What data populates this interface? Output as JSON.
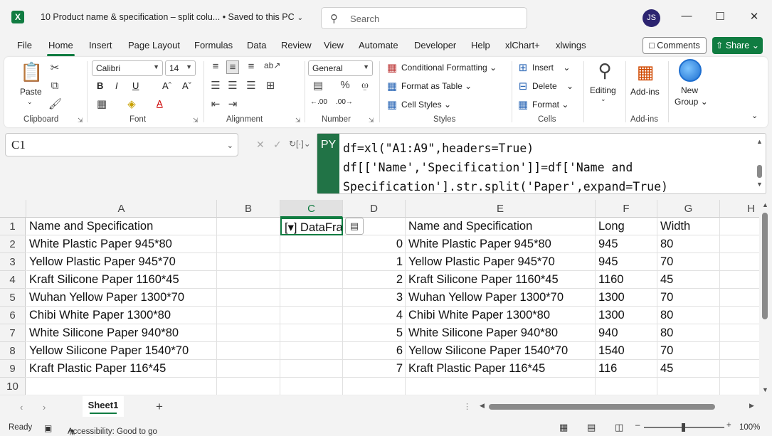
{
  "titlebar": {
    "logo": "X",
    "doc_title": "10 Product name & specification – split colu... • Saved to this PC",
    "search_placeholder": "Search",
    "avatar_initials": "JS"
  },
  "menu": {
    "tabs": [
      "File",
      "Home",
      "Insert",
      "Page Layout",
      "Formulas",
      "Data",
      "Review",
      "View",
      "Automate",
      "Developer",
      "Help",
      "xlChart+",
      "xlwings"
    ],
    "active": "Home",
    "comments_label": "Comments",
    "share_label": "Share"
  },
  "ribbon": {
    "clipboard": {
      "paste": "Paste",
      "label": "Clipboard"
    },
    "font": {
      "name": "Calibri",
      "size": "14",
      "label": "Font"
    },
    "alignment": {
      "label": "Alignment"
    },
    "number": {
      "format": "General",
      "label": "Number"
    },
    "styles": {
      "conditional": "Conditional Formatting",
      "format_table": "Format as Table",
      "cell_styles": "Cell Styles",
      "label": "Styles"
    },
    "cells": {
      "insert": "Insert",
      "delete": "Delete",
      "format": "Format",
      "label": "Cells"
    },
    "editing": {
      "label": "Editing"
    },
    "addins": {
      "button": "Add-ins",
      "label": "Add-ins"
    },
    "newgroup": {
      "line1": "New",
      "line2": "Group"
    }
  },
  "formula": {
    "name_box": "C1",
    "py_badge": "PY",
    "lines": [
      "df=xl(\"A1:A9\",headers=True)",
      "df[['Name','Specification']]=df['Name and",
      "Specification'].str.split('Paper',expand=True)"
    ]
  },
  "grid": {
    "columns": [
      "A",
      "B",
      "C",
      "D",
      "E",
      "F",
      "G",
      "H"
    ],
    "selected_column": "C",
    "rows": [
      "1",
      "2",
      "3",
      "4",
      "5",
      "6",
      "7",
      "8",
      "9",
      "10"
    ],
    "col_a": [
      "Name and Specification",
      "White Plastic Paper 945*80",
      "Yellow Plastic Paper 945*70",
      "Kraft Silicone Paper 1160*45",
      "Wuhan Yellow Paper 1300*70",
      "Chibi White Paper 1300*80",
      "White Silicone Paper 940*80",
      "Yellow Silicone Paper 1540*70",
      "Kraft Plastic Paper 116*45"
    ],
    "c1_value": "[▾] DataFra",
    "col_d": [
      "",
      "0",
      "1",
      "2",
      "3",
      "4",
      "5",
      "6",
      "7"
    ],
    "col_e": [
      "Name and Specification",
      "White Plastic Paper 945*80",
      "Yellow Plastic Paper 945*70",
      "Kraft Silicone Paper 1160*45",
      "Wuhan Yellow Paper 1300*70",
      "Chibi White Paper 1300*80",
      "White Silicone Paper 940*80",
      "Yellow Silicone Paper 1540*70",
      "Kraft Plastic Paper 116*45"
    ],
    "col_f": [
      "Long",
      "945",
      "945",
      "1160",
      "1300",
      "1300",
      "940",
      "1540",
      "116"
    ],
    "col_g": [
      "Width",
      "80",
      "70",
      "45",
      "70",
      "80",
      "80",
      "70",
      "45"
    ]
  },
  "sheets": {
    "active": "Sheet1"
  },
  "status": {
    "ready": "Ready",
    "accessibility": "Accessibility: Good to go",
    "zoom": "100%"
  }
}
